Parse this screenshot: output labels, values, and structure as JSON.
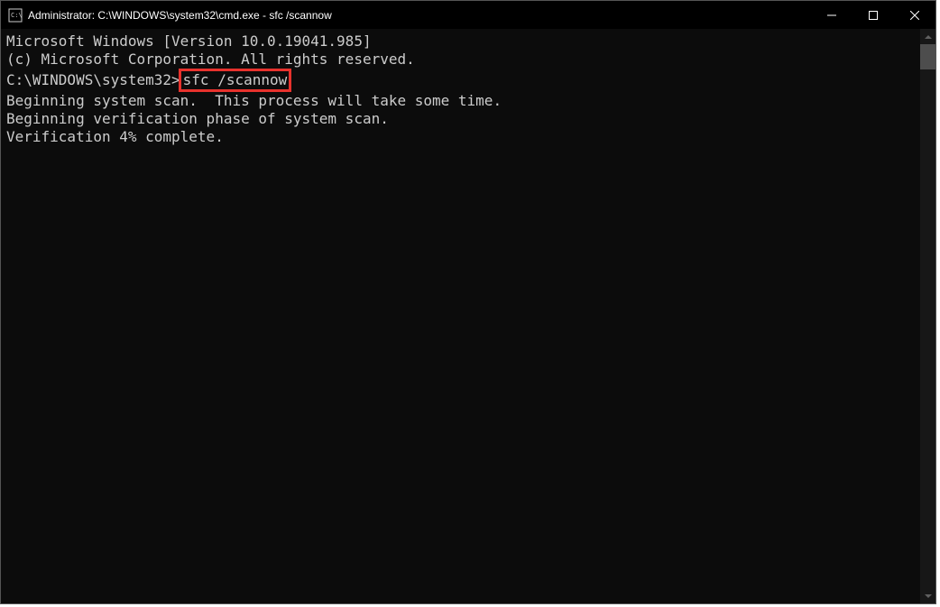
{
  "titlebar": {
    "title": "Administrator: C:\\WINDOWS\\system32\\cmd.exe - sfc  /scannow"
  },
  "terminal": {
    "line1": "Microsoft Windows [Version 10.0.19041.985]",
    "line2": "(c) Microsoft Corporation. All rights reserved.",
    "blank1": "",
    "prompt_path": "C:\\WINDOWS\\system32>",
    "command": "sfc /scannow",
    "blank2": "",
    "line_scan": "Beginning system scan.  This process will take some time.",
    "blank3": "",
    "line_verify1": "Beginning verification phase of system scan.",
    "line_verify2": "Verification 4% complete."
  }
}
